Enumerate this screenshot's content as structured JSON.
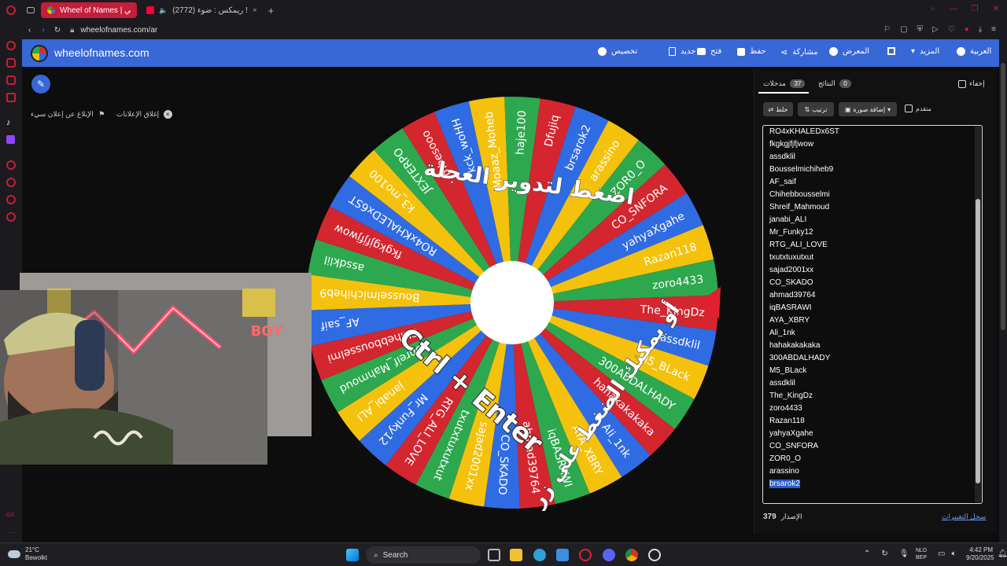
{
  "browser": {
    "tabs": [
      {
        "label": "Wheel of Names | عشوائي",
        "active": true
      },
      {
        "label": "(2772) ريمكس : ضوء !",
        "active": false
      }
    ],
    "new_tab": "+",
    "url": "wheelofnames.com/ar"
  },
  "site": {
    "brand": "wheelofnames.com",
    "menu": {
      "customize": "تخصيص",
      "new": "جديد",
      "open": "فتح",
      "save": "حفظ",
      "share": "مشاركة",
      "gallery": "المعرض",
      "more": "المزيد",
      "language": "العربية"
    },
    "ads": {
      "close_ads": "إغلاق الإعلانات",
      "report_ad": "الإبلاغ عن إعلان سيء"
    }
  },
  "wheel": {
    "center_text_line1": "اضغط لتدوير العجلة",
    "center_text_line2": "Ctrl + Enter",
    "center_text_line3": "أو يمكنك الضغط على زر",
    "segment_colors": [
      "#d3262f",
      "#2f6be3",
      "#f4c20d",
      "#2ea84f"
    ],
    "pointer_color": "#e0202f",
    "slices": [
      "The_KingDz",
      "assdklil",
      "M5_BLack",
      "300ABDALHADY",
      "hahakakakaka",
      "Ali_1nk",
      "AYA_XBRY",
      "iqBASRAWI",
      "ahmad39764",
      "CO_SKADO",
      "sajad2001xx",
      "txutxtuxutxut",
      "RTG_ALI_LOVE",
      "Mr_Funky12",
      "janabi_ALI",
      "Shreif_Mahmoud",
      "Chihebbousselmi",
      "AF_saif",
      "Bousselmichiheb9",
      "assdklil",
      "fkgkgjfjfjwow",
      "RO4xKHALEDx6ST",
      "k3_mo100",
      "JEXTERPO",
      "mbesooo",
      "kck_woHH",
      "Moaaz_Moheb",
      "haje100",
      "Dfujiq",
      "brsarok2",
      "arassino",
      "ZOR0_O",
      "CO_SNFORA",
      "yahyaXgahe",
      "Razan118",
      "zoro4433"
    ]
  },
  "panel": {
    "tabs": {
      "entries_label": "مدخلات",
      "entries_count": "37",
      "results_label": "النتائج",
      "results_count": "0",
      "hide_label": "إخفاء"
    },
    "buttons": {
      "shuffle": "خلط",
      "sort": "ترتيب",
      "add_image": "إضافة صورة",
      "advanced": "متقدم"
    },
    "entries": [
      "RO4xKHALEDx6ST",
      "fkgkgjfjfjwow",
      "assdklil",
      "Bousselmichiheb9",
      "AF_saif",
      "Chihebbousselmi",
      "Shreif_Mahmoud",
      "janabi_ALI",
      "Mr_Funky12",
      "RTG_ALI_LOVE",
      "txutxtuxutxut",
      "sajad2001xx",
      "CO_SKADO",
      "ahmad39764",
      "iqBASRAWI",
      "AYA_XBRY",
      "Ali_1nk",
      "hahakakakaka",
      "300ABDALHADY",
      "M5_BLack",
      "assdklil",
      "The_KingDz",
      "zoro4433",
      "Razan118",
      "yahyaXgahe",
      "CO_SNFORA",
      "ZOR0_O",
      "arassino",
      "brsarok2"
    ],
    "selected_entry": "brsarok2",
    "version_label": "الإصدار",
    "version_number": "379",
    "changelog": "سجل التغييرات"
  },
  "webcam": {
    "neon_text": "BOY"
  },
  "taskbar": {
    "weather_temp": "21°C",
    "weather_desc": "Bewolkt",
    "search": "Search",
    "lang_top": "NLD",
    "lang_bottom": "BEP",
    "time": "4:42 PM",
    "date": "9/20/2025"
  }
}
